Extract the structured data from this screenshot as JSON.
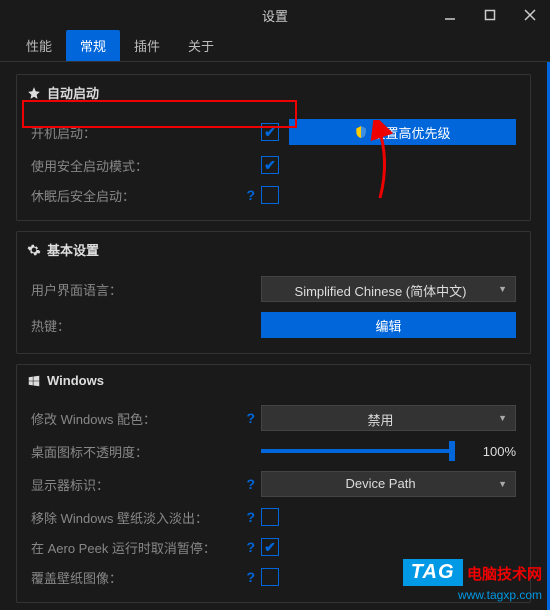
{
  "window": {
    "title": "设置"
  },
  "tabs": {
    "t0": "性能",
    "t1": "常规",
    "t2": "插件",
    "t3": "关于",
    "active": 1
  },
  "sections": {
    "autostart": {
      "title": "自动启动",
      "rows": {
        "boot": {
          "label": "开机启动：",
          "checked": true
        },
        "priority_btn": "设置高优先级",
        "safemode": {
          "label": "使用安全启动模式：",
          "checked": true
        },
        "sleep": {
          "label": "休眠后安全启动：",
          "checked": false
        }
      }
    },
    "basic": {
      "title": "基本设置",
      "lang": {
        "label": "用户界面语言：",
        "value": "Simplified Chinese (简体中文)"
      },
      "hotkey": {
        "label": "热键：",
        "btn": "编辑"
      }
    },
    "windows": {
      "title": "Windows",
      "color": {
        "label": "修改 Windows 配色：",
        "value": "禁用"
      },
      "opacity": {
        "label": "桌面图标不透明度：",
        "value": "100%",
        "percent": 100
      },
      "monitor": {
        "label": "显示器标识：",
        "value": "Device Path"
      },
      "fade": {
        "label": "移除 Windows 壁纸淡入淡出：",
        "checked": false
      },
      "aero": {
        "label": "在 Aero Peek 运行时取消暂停：",
        "checked": true
      },
      "cover": {
        "label": "覆盖壁纸图像：",
        "checked": false
      }
    }
  },
  "watermark": {
    "badge": "TAG",
    "line1": "电脑技术网",
    "line2": "www.tagxp.com"
  }
}
